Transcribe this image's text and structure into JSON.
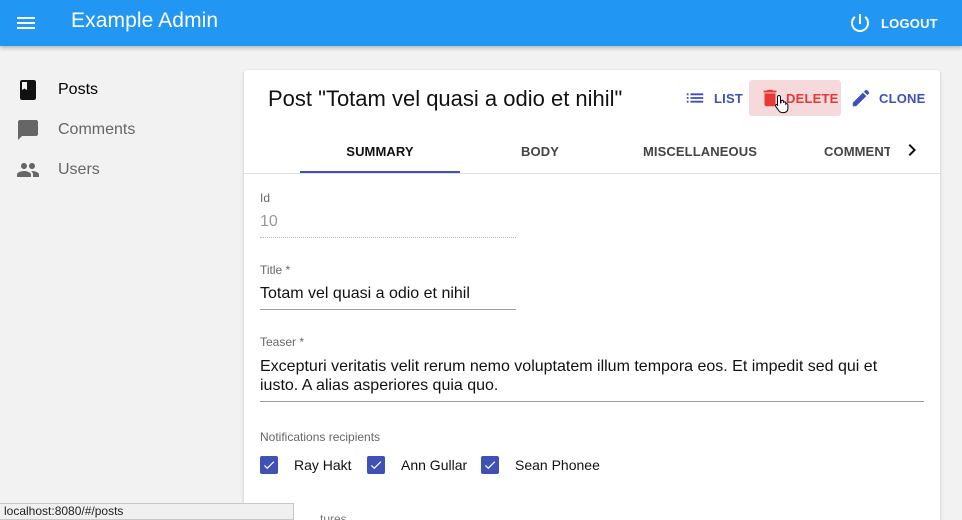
{
  "app": {
    "title": "Example Admin",
    "logout_label": "LOGOUT"
  },
  "sidebar": {
    "items": [
      {
        "label": "Posts",
        "icon": "book-icon",
        "active": true
      },
      {
        "label": "Comments",
        "icon": "comment-icon",
        "active": false
      },
      {
        "label": "Users",
        "icon": "people-icon",
        "active": false
      }
    ]
  },
  "post": {
    "heading": "Post \"Totam vel quasi a odio et nihil\"",
    "actions": {
      "list": "LIST",
      "delete": "DELETE",
      "clone": "CLONE"
    }
  },
  "tabs": [
    {
      "label": "SUMMARY",
      "selected": true
    },
    {
      "label": "BODY",
      "selected": false
    },
    {
      "label": "MISCELLANEOUS",
      "selected": false
    },
    {
      "label": "COMMENTS",
      "selected": false
    }
  ],
  "fields": {
    "id": {
      "label": "Id",
      "value": "10"
    },
    "title": {
      "label": "Title *",
      "value": "Totam vel quasi a odio et nihil"
    },
    "teaser": {
      "label": "Teaser *",
      "value": "Excepturi veritatis velit rerum nemo voluptatem illum tempora eos. Et impedit sed qui et iusto. A alias asperiores quia quo."
    },
    "notifications": {
      "label": "Notifications recipients",
      "options": [
        {
          "label": "Ray Hakt",
          "checked": true
        },
        {
          "label": "Ann Gullar",
          "checked": true
        },
        {
          "label": "Sean Phonee",
          "checked": true
        }
      ]
    }
  },
  "partial_label": "tures",
  "statusbar": {
    "url": "localhost:8080/#/posts"
  },
  "colors": {
    "appbar": "#2196f3",
    "primary": "#3f51b5",
    "danger": "#e53935"
  }
}
